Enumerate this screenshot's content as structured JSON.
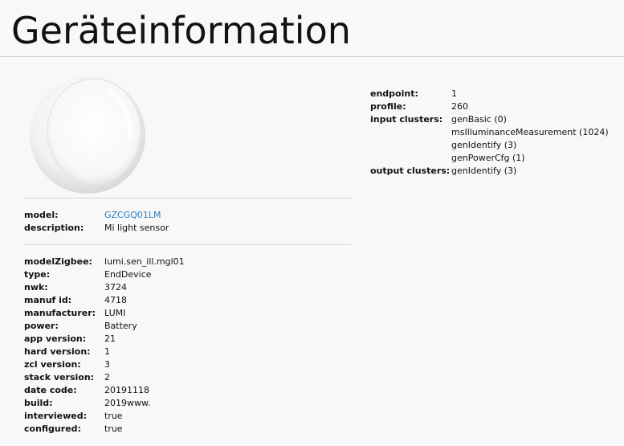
{
  "page_title": "Geräteinformation",
  "device": {
    "model_label": "model:",
    "model_value": "GZCGQ01LM",
    "description_label": "description:",
    "description_value": "Mi light sensor"
  },
  "details": [
    {
      "label": "modelZigbee:",
      "value": "lumi.sen_ill.mgl01"
    },
    {
      "label": "type:",
      "value": "EndDevice"
    },
    {
      "label": "nwk:",
      "value": "3724"
    },
    {
      "label": "manuf id:",
      "value": "4718"
    },
    {
      "label": "manufacturer:",
      "value": "LUMI"
    },
    {
      "label": "power:",
      "value": "Battery"
    },
    {
      "label": "app version:",
      "value": "21"
    },
    {
      "label": "hard version:",
      "value": "1"
    },
    {
      "label": "zcl version:",
      "value": "3"
    },
    {
      "label": "stack version:",
      "value": "2"
    },
    {
      "label": "date code:",
      "value": "20191118"
    },
    {
      "label": "build:",
      "value": "2019www."
    },
    {
      "label": "interviewed:",
      "value": "true"
    },
    {
      "label": "configured:",
      "value": "true"
    }
  ],
  "endpoint": {
    "endpoint_label": "endpoint:",
    "endpoint_value": "1",
    "profile_label": "profile:",
    "profile_value": "260",
    "input_clusters_label": "input clusters:",
    "input_clusters": [
      "genBasic (0)",
      "msIlluminanceMeasurement (1024)",
      "genIdentify (3)",
      "genPowerCfg (1)"
    ],
    "output_clusters_label": "output clusters:",
    "output_clusters": [
      "genIdentify (3)"
    ]
  }
}
